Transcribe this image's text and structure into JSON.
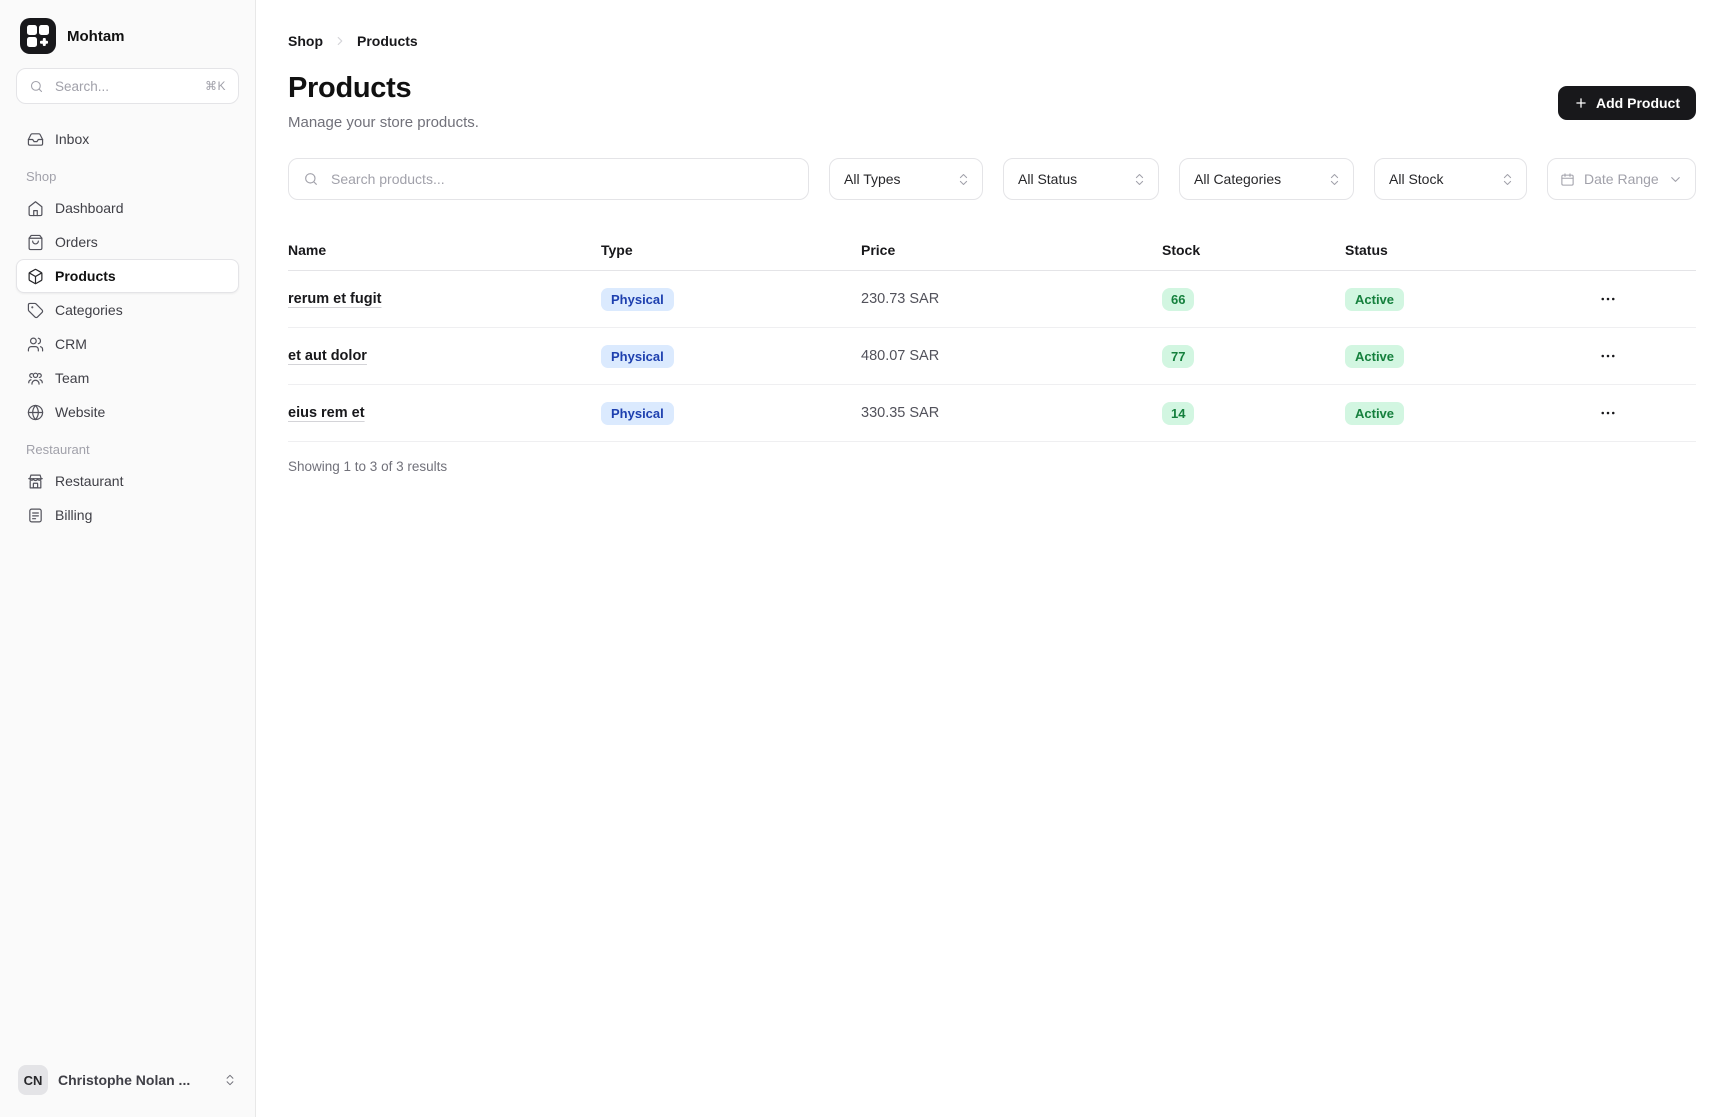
{
  "brand": {
    "name": "Mohtam"
  },
  "sidebar": {
    "search": {
      "placeholder": "Search...",
      "shortcut": "⌘K"
    },
    "sections": [
      {
        "label": "",
        "items": [
          {
            "label": "Inbox",
            "icon": "inbox-icon"
          }
        ]
      },
      {
        "label": "Shop",
        "items": [
          {
            "label": "Dashboard",
            "icon": "home-icon"
          },
          {
            "label": "Orders",
            "icon": "shopping-bag-icon"
          },
          {
            "label": "Products",
            "icon": "package-icon",
            "active": true
          },
          {
            "label": "Categories",
            "icon": "tag-icon"
          },
          {
            "label": "CRM",
            "icon": "users-icon"
          },
          {
            "label": "Team",
            "icon": "team-icon"
          },
          {
            "label": "Website",
            "icon": "globe-icon"
          }
        ]
      },
      {
        "label": "Restaurant",
        "items": [
          {
            "label": "Restaurant",
            "icon": "storefront-icon"
          },
          {
            "label": "Billing",
            "icon": "receipt-icon"
          }
        ]
      }
    ],
    "user": {
      "initials": "CN",
      "name": "Christophe Nolan ..."
    }
  },
  "breadcrumb": {
    "parent": "Shop",
    "current": "Products"
  },
  "header": {
    "title": "Products",
    "subtitle": "Manage your store products.",
    "add_button_label": "Add Product"
  },
  "filters": {
    "search_placeholder": "Search products...",
    "type_filter": "All Types",
    "status_filter": "All Status",
    "category_filter": "All Categories",
    "stock_filter": "All Stock",
    "date_range": "Date Range"
  },
  "table": {
    "columns": {
      "name": "Name",
      "type": "Type",
      "price": "Price",
      "stock": "Stock",
      "status": "Status"
    },
    "rows": [
      {
        "name": "rerum et fugit",
        "type": "Physical",
        "price": "230.73 SAR",
        "stock": "66",
        "status": "Active"
      },
      {
        "name": "et aut dolor",
        "type": "Physical",
        "price": "480.07 SAR",
        "stock": "77",
        "status": "Active"
      },
      {
        "name": "eius rem et",
        "type": "Physical",
        "price": "330.35 SAR",
        "stock": "14",
        "status": "Active"
      }
    ],
    "footer": "Showing 1 to 3 of 3 results"
  },
  "colors": {
    "accent_dark": "#18181b",
    "sidebar_bg": "#fafafa",
    "type_badge_bg": "#dbeafe",
    "type_badge_text": "#1e40af",
    "green_badge_bg": "#d2f6e1",
    "green_badge_text": "#15803d"
  }
}
